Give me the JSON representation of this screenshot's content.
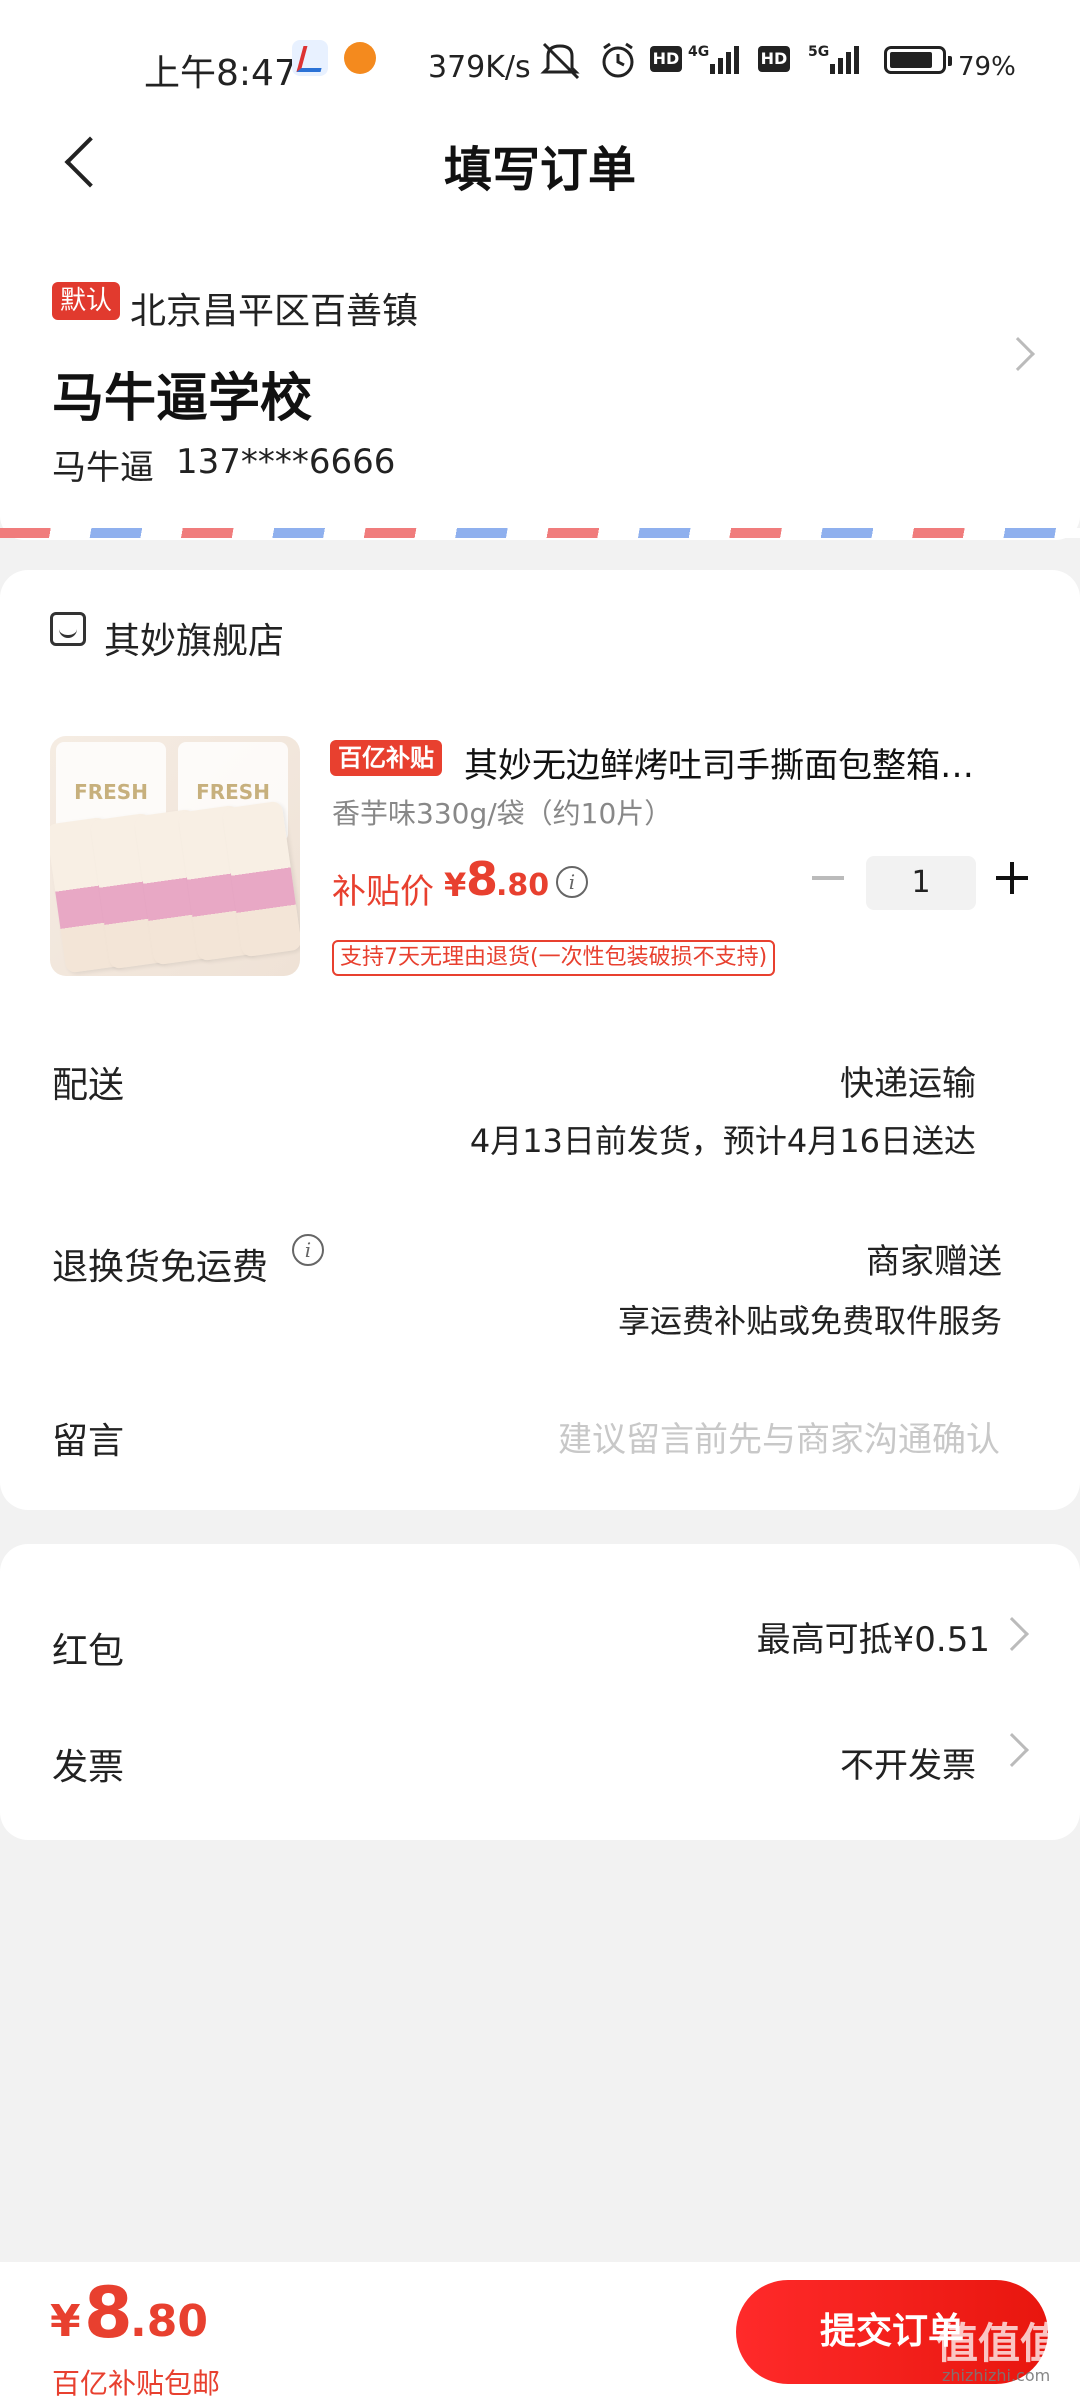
{
  "status_bar": {
    "time": "上午8:47",
    "speed": "379K/s",
    "hd1": "HD",
    "net1": "4G",
    "hd2": "HD",
    "net2": "5G",
    "battery": "79%"
  },
  "header": {
    "title": "填写订单",
    "back_icon": "chevron-left-icon"
  },
  "address": {
    "badge": "默认",
    "region": "北京昌平区百善镇",
    "detail": "马牛逼学校",
    "name": "马牛逼",
    "phone": "137****6666"
  },
  "store": {
    "icon": "store-icon",
    "name": "其妙旗舰店",
    "product": {
      "tag": "百亿补贴",
      "title": "其妙无边鲜烤吐司手撕面包整箱…",
      "spec": "香芋味330g/袋（约10片）",
      "price_label": "补贴价",
      "price_symbol": "¥",
      "price_int": "8",
      "price_dec": ".80",
      "quantity": "1",
      "return_policy": "支持7天无理由退货(一次性包装破损不支持)",
      "image_label": "FRESH"
    },
    "delivery": {
      "label": "配送",
      "method": "快递运输",
      "eta": "4月13日前发货，预计4月16日送达"
    },
    "return_shipping": {
      "label": "退换货免运费",
      "value": "商家赠送",
      "desc": "享运费补贴或免费取件服务"
    },
    "message": {
      "label": "留言",
      "placeholder": "建议留言前先与商家沟通确认"
    }
  },
  "extras": {
    "red_packet": {
      "label": "红包",
      "value": "最高可抵¥0.51"
    },
    "invoice": {
      "label": "发票",
      "value": "不开发票"
    }
  },
  "bottom": {
    "symbol": "¥",
    "total_int": "8",
    "total_dec": ".80",
    "note": "百亿补贴包邮",
    "submit": "提交订单",
    "watermark": "值值值",
    "watermark_url": "zhizhizhi.com"
  },
  "colors": {
    "accent": "#e8402f",
    "submit": "#ff2a2a",
    "page_bg": "#f2f2f2"
  }
}
